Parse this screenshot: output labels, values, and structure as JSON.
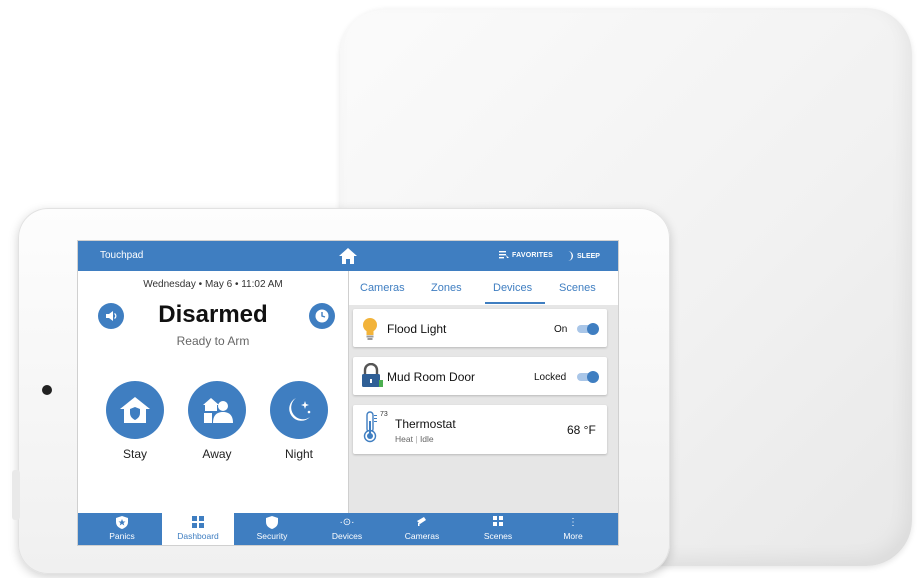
{
  "topbar": {
    "title": "Touchpad",
    "favorites": "FAVORITES",
    "sleep": "SLEEP"
  },
  "left_panel": {
    "date": "Wednesday",
    "date2": "May 6",
    "time": "11:02 AM",
    "status": "Disarmed",
    "substatus": "Ready to Arm",
    "arm_buttons": [
      {
        "label": "Stay",
        "icon": "home-shield-icon"
      },
      {
        "label": "Away",
        "icon": "people-icon"
      },
      {
        "label": "Night",
        "icon": "moon-stars-icon"
      }
    ]
  },
  "right_panel": {
    "tabs": [
      "Cameras",
      "Zones",
      "Devices",
      "Scenes"
    ],
    "active_tab": "Devices",
    "devices": [
      {
        "name": "Flood Light",
        "value": "On",
        "icon": "lightbulb-icon",
        "toggle": true
      },
      {
        "name": "Mud Room Door",
        "value": "Locked",
        "icon": "lock-icon",
        "toggle": true
      },
      {
        "name": "Thermostat",
        "value": "68 °F",
        "setpoint": "73",
        "mode": "Heat",
        "state": "Idle",
        "icon": "thermometer-icon"
      }
    ]
  },
  "bottom_nav": {
    "items": [
      {
        "label": "Panics",
        "icon": "shield-star-icon"
      },
      {
        "label": "Dashboard",
        "icon": "grid-icon"
      },
      {
        "label": "Security",
        "icon": "shield-icon"
      },
      {
        "label": "Devices",
        "icon": "devices-icon"
      },
      {
        "label": "Cameras",
        "icon": "camera-icon"
      },
      {
        "label": "Scenes",
        "icon": "scenes-icon"
      },
      {
        "label": "More",
        "icon": "more-vertical-icon"
      }
    ],
    "active": "Dashboard"
  },
  "colors": {
    "accent": "#3f7ec1",
    "panel_bg": "#e6e6e6",
    "bulb": "#f2b33a"
  }
}
